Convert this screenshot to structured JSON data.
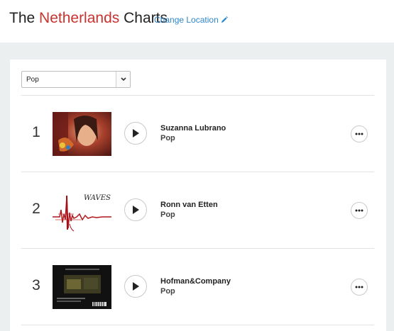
{
  "header": {
    "title_prefix": "The",
    "title_country": "Netherlands",
    "title_suffix": "Charts",
    "change_location_label": "Change Location",
    "accent_color": "#c8332f",
    "link_color": "#2f86c9"
  },
  "filter": {
    "selected_genre": "Pop"
  },
  "chart": [
    {
      "rank": "1",
      "artist": "Suzanna Lubrano",
      "genre": "Pop",
      "thumb": "portrait-photo"
    },
    {
      "rank": "2",
      "artist": "Ronn van Etten",
      "genre": "Pop",
      "thumb": "waves-artwork",
      "thumb_text": "WAVES"
    },
    {
      "rank": "3",
      "artist": "Hofman&Company",
      "genre": "Pop",
      "thumb": "album-back-cover"
    }
  ],
  "icons": {
    "play": "play-icon",
    "more": "more-options-icon",
    "edit": "pencil-icon",
    "dropdown": "chevron-down-icon"
  }
}
